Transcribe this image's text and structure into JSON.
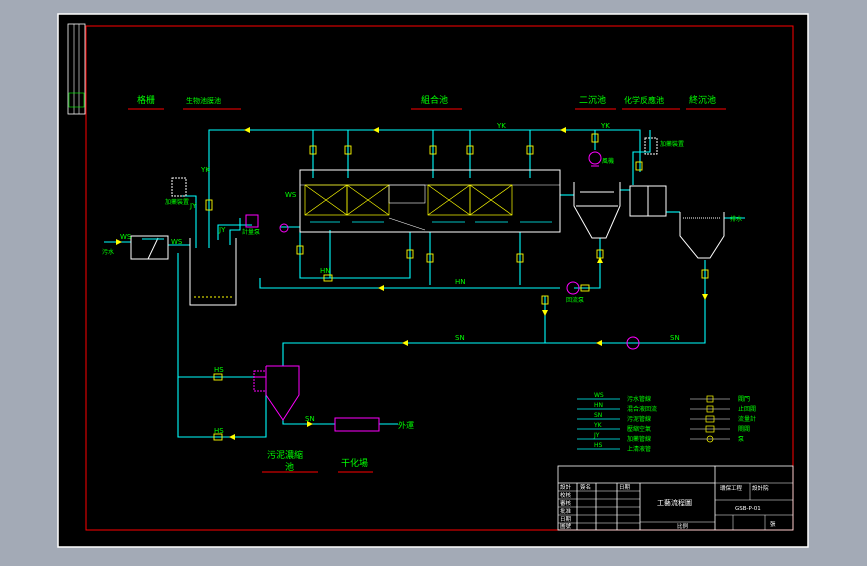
{
  "colors": {
    "background": "#000000",
    "frame": "#ffffff",
    "border": "#ff0000",
    "pipe": "#00ffff",
    "equipment": "#ffffff",
    "pump": "#ff00ff",
    "label": "#00ff00",
    "valve": "#ffff00",
    "title_block": "#ffffff"
  },
  "titles": {
    "grille": "格栅",
    "biofilm": "生物池膜池",
    "combined": "組合池",
    "secondary": "二沉池",
    "chemical": "化学反應池",
    "final_settle": "終沉池",
    "sludge": "污泥濃縮",
    "sludge_2": "池",
    "drying": "干化場"
  },
  "equipment_labels": {
    "intake": "污水",
    "dosing_left": "加藥裝置",
    "dosing_right": "加藥裝置",
    "pump_label": "計量泵",
    "blower": "風機",
    "return_pump": "回流泵",
    "outfall": "排水",
    "haul": "外運"
  },
  "pipe_labels": {
    "ws": "WS",
    "yk": "YK",
    "jy": "JY",
    "hn": "HN",
    "sn": "SN",
    "hs": "HS"
  },
  "legend_lines": [
    {
      "code": "WS",
      "text": "污水管線"
    },
    {
      "code": "HN",
      "text": "混合液回流"
    },
    {
      "code": "SN",
      "text": "污泥管線"
    },
    {
      "code": "YK",
      "text": "壓縮空氣"
    },
    {
      "code": "JY",
      "text": "加藥管線"
    },
    {
      "code": "HS",
      "text": "上清液管"
    }
  ],
  "legend_symbols": [
    {
      "text": "閥門"
    },
    {
      "text": "止回閥"
    },
    {
      "text": "流量計"
    },
    {
      "text": "閘閥"
    },
    {
      "text": "泵"
    }
  ],
  "title_block": {
    "drawing_title": "工藝流程圖",
    "project_label": "環保工程",
    "company": "設計院",
    "drawing_no": "GSB-P-01",
    "scale_label": "比例",
    "sheet": "張",
    "rows_left": [
      "設計",
      "校核",
      "審核",
      "批准",
      "日期",
      "圖號"
    ],
    "cells_mid": [
      "簽名",
      "日期"
    ]
  }
}
